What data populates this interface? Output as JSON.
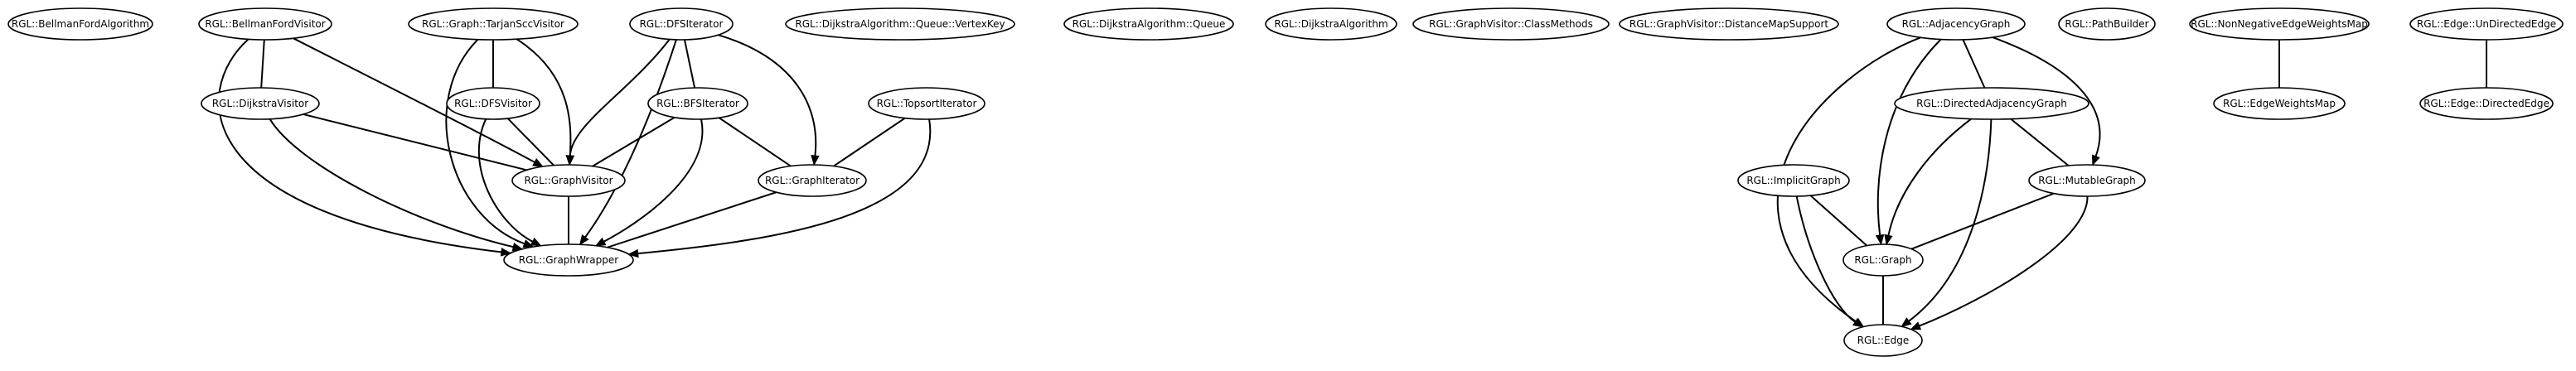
{
  "nodes": [
    {
      "id": "bellmanfordalgorithm",
      "label": "RGL::BellmanFordAlgorithm"
    },
    {
      "id": "bellmanfordvisitor",
      "label": "RGL::BellmanFordVisitor"
    },
    {
      "id": "tarjansccvisitor",
      "label": "RGL::Graph::TarjanSccVisitor"
    },
    {
      "id": "dfsiterator",
      "label": "RGL::DFSIterator"
    },
    {
      "id": "dijkstra-queue-vertexkey",
      "label": "RGL::DijkstraAlgorithm::Queue::VertexKey"
    },
    {
      "id": "dijkstra-queue",
      "label": "RGL::DijkstraAlgorithm::Queue"
    },
    {
      "id": "dijkstraalgorithm",
      "label": "RGL::DijkstraAlgorithm"
    },
    {
      "id": "graphvisitor-classmethods",
      "label": "RGL::GraphVisitor::ClassMethods"
    },
    {
      "id": "graphvisitor-distancemapsupport",
      "label": "RGL::GraphVisitor::DistanceMapSupport"
    },
    {
      "id": "adjacencygraph",
      "label": "RGL::AdjacencyGraph"
    },
    {
      "id": "pathbuilder",
      "label": "RGL::PathBuilder"
    },
    {
      "id": "nonnegativeedgeweightsmap",
      "label": "RGL::NonNegativeEdgeWeightsMap"
    },
    {
      "id": "undirectededge",
      "label": "RGL::Edge::UnDirectedEdge"
    },
    {
      "id": "dijkstravisitor",
      "label": "RGL::DijkstraVisitor"
    },
    {
      "id": "dfsvisitor",
      "label": "RGL::DFSVisitor"
    },
    {
      "id": "bfsiterator",
      "label": "RGL::BFSIterator"
    },
    {
      "id": "topsortiterator",
      "label": "RGL::TopsortIterator"
    },
    {
      "id": "directedadjacencygraph",
      "label": "RGL::DirectedAdjacencyGraph"
    },
    {
      "id": "edgeweightsmap",
      "label": "RGL::EdgeWeightsMap"
    },
    {
      "id": "directededge",
      "label": "RGL::Edge::DirectedEdge"
    },
    {
      "id": "graphvisitor",
      "label": "RGL::GraphVisitor"
    },
    {
      "id": "graphiterator",
      "label": "RGL::GraphIterator"
    },
    {
      "id": "implicitgraph",
      "label": "RGL::ImplicitGraph"
    },
    {
      "id": "mutablegraph",
      "label": "RGL::MutableGraph"
    },
    {
      "id": "graphwrapper",
      "label": "RGL::GraphWrapper"
    },
    {
      "id": "graph",
      "label": "RGL::Graph"
    },
    {
      "id": "edge",
      "label": "RGL::Edge"
    }
  ],
  "edges": [
    {
      "from": "bellmanfordvisitor",
      "to": "dijkstravisitor"
    },
    {
      "from": "bellmanfordvisitor",
      "to": "graphvisitor"
    },
    {
      "from": "bellmanfordvisitor",
      "to": "graphwrapper"
    },
    {
      "from": "tarjansccvisitor",
      "to": "dfsvisitor"
    },
    {
      "from": "tarjansccvisitor",
      "to": "graphvisitor"
    },
    {
      "from": "tarjansccvisitor",
      "to": "graphwrapper"
    },
    {
      "from": "dfsiterator",
      "to": "bfsiterator"
    },
    {
      "from": "dfsiterator",
      "to": "graphiterator"
    },
    {
      "from": "dfsiterator",
      "to": "graphvisitor"
    },
    {
      "from": "dfsiterator",
      "to": "graphwrapper"
    },
    {
      "from": "dijkstravisitor",
      "to": "graphvisitor"
    },
    {
      "from": "dijkstravisitor",
      "to": "graphwrapper"
    },
    {
      "from": "dfsvisitor",
      "to": "graphvisitor"
    },
    {
      "from": "dfsvisitor",
      "to": "graphwrapper"
    },
    {
      "from": "bfsiterator",
      "to": "graphvisitor"
    },
    {
      "from": "bfsiterator",
      "to": "graphiterator"
    },
    {
      "from": "bfsiterator",
      "to": "graphwrapper"
    },
    {
      "from": "topsortiterator",
      "to": "graphiterator"
    },
    {
      "from": "topsortiterator",
      "to": "graphwrapper"
    },
    {
      "from": "graphvisitor",
      "to": "graphwrapper"
    },
    {
      "from": "graphiterator",
      "to": "graphwrapper"
    },
    {
      "from": "adjacencygraph",
      "to": "directedadjacencygraph"
    },
    {
      "from": "adjacencygraph",
      "to": "mutablegraph"
    },
    {
      "from": "adjacencygraph",
      "to": "graph"
    },
    {
      "from": "adjacencygraph",
      "to": "edge"
    },
    {
      "from": "directedadjacencygraph",
      "to": "mutablegraph"
    },
    {
      "from": "directedadjacencygraph",
      "to": "graph"
    },
    {
      "from": "directedadjacencygraph",
      "to": "edge"
    },
    {
      "from": "implicitgraph",
      "to": "graph"
    },
    {
      "from": "implicitgraph",
      "to": "edge"
    },
    {
      "from": "mutablegraph",
      "to": "graph"
    },
    {
      "from": "mutablegraph",
      "to": "edge"
    },
    {
      "from": "graph",
      "to": "edge"
    },
    {
      "from": "nonnegativeedgeweightsmap",
      "to": "edgeweightsmap"
    },
    {
      "from": "undirectededge",
      "to": "directededge"
    }
  ]
}
